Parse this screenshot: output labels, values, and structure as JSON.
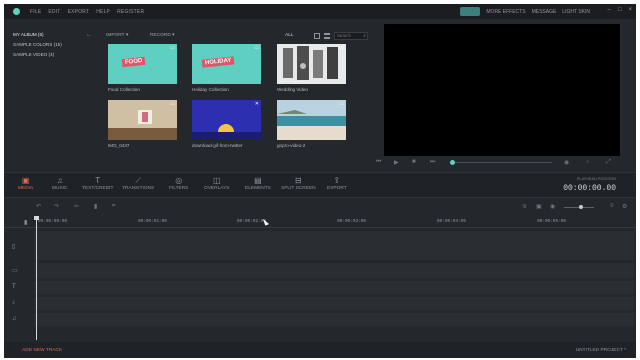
{
  "menu": [
    "FILE",
    "EDIT",
    "EXPORT",
    "HELP",
    "REGISTER"
  ],
  "topright": {
    "pill_label": "",
    "more_effects": "MORE EFFECTS",
    "message": "MESSAGE",
    "light_skin": "LIGHT SKIN"
  },
  "album": [
    "MY ALBUM (6)",
    "SAMPLE COLORS (15)",
    "SAMPLE VIDEO (3)"
  ],
  "media_toolbar": {
    "import": "IMPORT ▾",
    "record": "RECORD ▾",
    "filter": "ALL",
    "search_placeholder": "Search"
  },
  "media": [
    {
      "caption": "Food Collection",
      "banner": "FOOD"
    },
    {
      "caption": "Holiday Collection",
      "banner": "HOLIDAY"
    },
    {
      "caption": "Wedding Video",
      "banner": ""
    },
    {
      "caption": "IMG_0437",
      "banner": ""
    },
    {
      "caption": "download-gif-from-twitter",
      "banner": ""
    },
    {
      "caption": "gopro-video-2",
      "banner": ""
    }
  ],
  "tools": [
    "MEDIA",
    "MUSIC",
    "TEXT/CREDIT",
    "TRANSITIONS",
    "FILTERS",
    "OVERLAYS",
    "ELEMENTS",
    "SPLIT SCREEN",
    "EXPORT"
  ],
  "timecode": {
    "label": "PLAYHEAD POSITION",
    "value": "00:00:00.00"
  },
  "ruler": [
    "00:00:00:00",
    "00:00:01:00",
    "00:00:02:00",
    "00:00:03:00",
    "00:00:04:00",
    "00:00:05:00"
  ],
  "bottom": {
    "add_track": "ADD NEW TRACK",
    "project": "UNTITLED PROJECT *"
  },
  "colors": {
    "accent": "#5fd0c0",
    "active_tool": "#e06a5e",
    "banner": "#e0556a"
  }
}
